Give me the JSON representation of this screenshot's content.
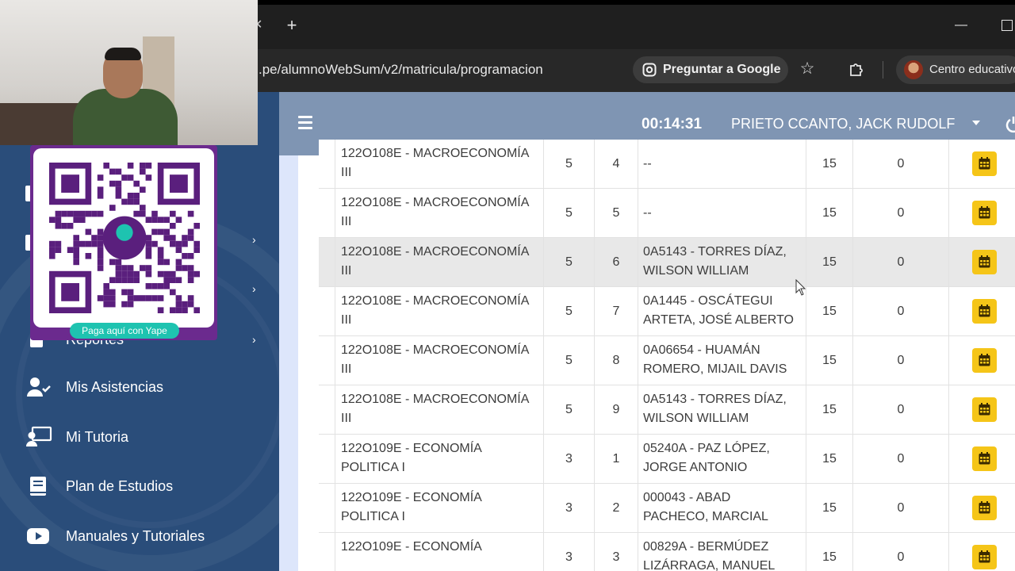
{
  "browser": {
    "new_tab_symbol": "+",
    "url": ".pe/alumnoWebSum/v2/matricula/programacion",
    "ask_google_label": "Preguntar a Google",
    "profile_label": "Centro educativo"
  },
  "sidebar": {
    "items": [
      {
        "label": "Reportes",
        "icon": "report-icon"
      },
      {
        "label": "Mis Asistencias",
        "icon": "user-check-icon"
      },
      {
        "label": "Mi Tutoria",
        "icon": "chalkboard-teacher-icon"
      },
      {
        "label": "Plan de Estudios",
        "icon": "book-icon"
      },
      {
        "label": "Manuales y Tutoriales",
        "icon": "youtube-icon"
      }
    ]
  },
  "header": {
    "timer": "00:14:31",
    "user_name": "PRIETO CCANTO, JACK RUDOLF"
  },
  "overlay": {
    "yape_label": "Paga aquí con Yape"
  },
  "table": {
    "rows": [
      {
        "course_line1": "122O108E - MACROECONOMÍA",
        "course_line2": "III",
        "credits": "5",
        "section": "4",
        "teacher_line1": "--",
        "teacher_line2": "",
        "capacity": "15",
        "enrolled": "0",
        "highlight": false
      },
      {
        "course_line1": "122O108E - MACROECONOMÍA",
        "course_line2": "III",
        "credits": "5",
        "section": "5",
        "teacher_line1": "--",
        "teacher_line2": "",
        "capacity": "15",
        "enrolled": "0",
        "highlight": false
      },
      {
        "course_line1": "122O108E - MACROECONOMÍA",
        "course_line2": "III",
        "credits": "5",
        "section": "6",
        "teacher_line1": "0A5143 - TORRES DÍAZ,",
        "teacher_line2": "WILSON WILLIAM",
        "capacity": "15",
        "enrolled": "0",
        "highlight": true
      },
      {
        "course_line1": "122O108E - MACROECONOMÍA",
        "course_line2": "III",
        "credits": "5",
        "section": "7",
        "teacher_line1": "0A1445 - OSCÁTEGUI",
        "teacher_line2": "ARTETA, JOSÉ ALBERTO",
        "capacity": "15",
        "enrolled": "0",
        "highlight": false
      },
      {
        "course_line1": "122O108E - MACROECONOMÍA",
        "course_line2": "III",
        "credits": "5",
        "section": "8",
        "teacher_line1": "0A06654 - HUAMÁN",
        "teacher_line2": "ROMERO, MIJAIL DAVIS",
        "capacity": "15",
        "enrolled": "0",
        "highlight": false
      },
      {
        "course_line1": "122O108E - MACROECONOMÍA",
        "course_line2": "III",
        "credits": "5",
        "section": "9",
        "teacher_line1": "0A5143 - TORRES DÍAZ,",
        "teacher_line2": "WILSON WILLIAM",
        "capacity": "15",
        "enrolled": "0",
        "highlight": false
      },
      {
        "course_line1": "122O109E - ECONOMÍA",
        "course_line2": "POLITICA I",
        "credits": "3",
        "section": "1",
        "teacher_line1": "05240A - PAZ LÓPEZ,",
        "teacher_line2": "JORGE ANTONIO",
        "capacity": "15",
        "enrolled": "0",
        "highlight": false
      },
      {
        "course_line1": "122O109E - ECONOMÍA",
        "course_line2": "POLITICA I",
        "credits": "3",
        "section": "2",
        "teacher_line1": "000043 - ABAD",
        "teacher_line2": "PACHECO, MARCIAL",
        "capacity": "15",
        "enrolled": "0",
        "highlight": false
      },
      {
        "course_line1": "122O109E - ECONOMÍA",
        "course_line2": "",
        "credits": "3",
        "section": "3",
        "teacher_line1": "00829A - BERMÚDEZ",
        "teacher_line2": "LIZÁRRAGA, MANUEL",
        "capacity": "15",
        "enrolled": "0",
        "highlight": false
      }
    ]
  },
  "colors": {
    "sidebar_bg": "#2a4d7a",
    "header_bg": "#7f95b3",
    "action_button": "#f5c518",
    "yape_purple": "#6b2a8e",
    "yape_teal": "#1ec3b0"
  }
}
